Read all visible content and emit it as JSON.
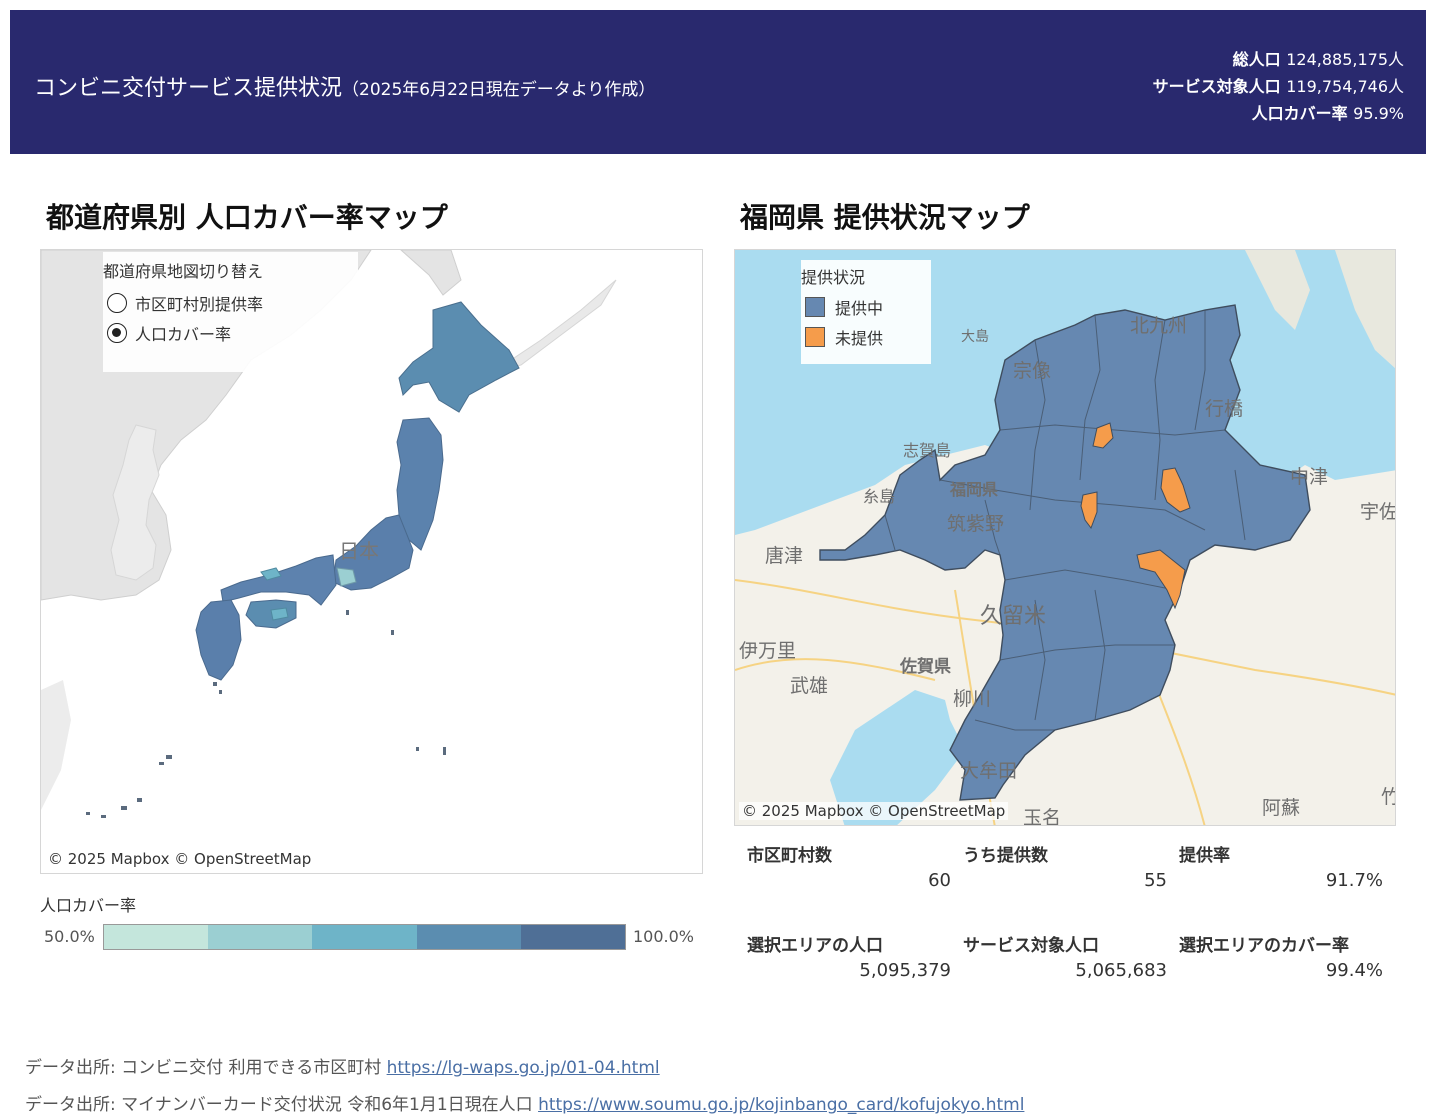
{
  "header": {
    "title": "コンビニ交付サービス提供状況",
    "subtitle": "（2025年6月22日現在データより作成）",
    "stats": [
      {
        "label": "総人口",
        "value": "124,885,175人"
      },
      {
        "label": "サービス対象人口",
        "value": "119,754,746人"
      },
      {
        "label": "人口カバー率",
        "value": "95.9%"
      }
    ]
  },
  "left_panel": {
    "title": "都道府県別 人口カバー率マップ",
    "switch": {
      "title": "都道府県地図切り替え",
      "options": [
        {
          "label": "市区町村別提供率",
          "selected": false
        },
        {
          "label": "人口カバー率",
          "selected": true
        }
      ]
    },
    "map_labels": {
      "country": "日本"
    },
    "credit": "© 2025 Mapbox  © OpenStreetMap",
    "ramp": {
      "title": "人口カバー率",
      "min": "50.0%",
      "max": "100.0%",
      "colors": [
        "#c4e6dc",
        "#9bcfd2",
        "#6eb4c8",
        "#5b8db0",
        "#4f6f96"
      ]
    }
  },
  "right_panel": {
    "title": "福岡県 提供状況マップ",
    "legend": {
      "title": "提供状況",
      "items": [
        {
          "label": "提供中",
          "color": "#6688b1"
        },
        {
          "label": "未提供",
          "color": "#f59c4b"
        }
      ]
    },
    "map_labels": {
      "kitakyushu": "北九州",
      "munakata": "宗像",
      "yukuhashi": "行橋",
      "shikanoshima": "志賀島",
      "fukuoka": "福岡県",
      "itoshima": "糸島",
      "chikushino": "筑紫野",
      "nakatsu": "中津",
      "usa": "宇佐",
      "karatsu": "唐津",
      "kurume": "久留米",
      "imari": "伊万里",
      "saga": "佐賀県",
      "takeo": "武雄",
      "yanagawa": "柳川",
      "omuta": "大牟田",
      "tamana": "玉名",
      "aso": "阿蘇",
      "oshima": "大島",
      "taketa": "竹"
    },
    "credit": "© 2025 Mapbox  © OpenStreetMap",
    "kpis": [
      {
        "label": "市区町村数",
        "value": "60"
      },
      {
        "label": "うち提供数",
        "value": "55"
      },
      {
        "label": "提供率",
        "value": "91.7%"
      },
      {
        "label": "選択エリアの人口",
        "value": "5,095,379"
      },
      {
        "label": "サービス対象人口",
        "value": "5,065,683"
      },
      {
        "label": "選択エリアのカバー率",
        "value": "99.4%"
      }
    ]
  },
  "sources": [
    {
      "prefix": "データ出所: コンビニ交付 利用できる市区町村",
      "link": "https://lg-waps.go.jp/01-04.html"
    },
    {
      "prefix": "データ出所: マイナンバーカード交付状況 令和6年1月1日現在人口",
      "link": "https://www.soumu.go.jp/kojinbango_card/kofujokyo.html"
    }
  ]
}
